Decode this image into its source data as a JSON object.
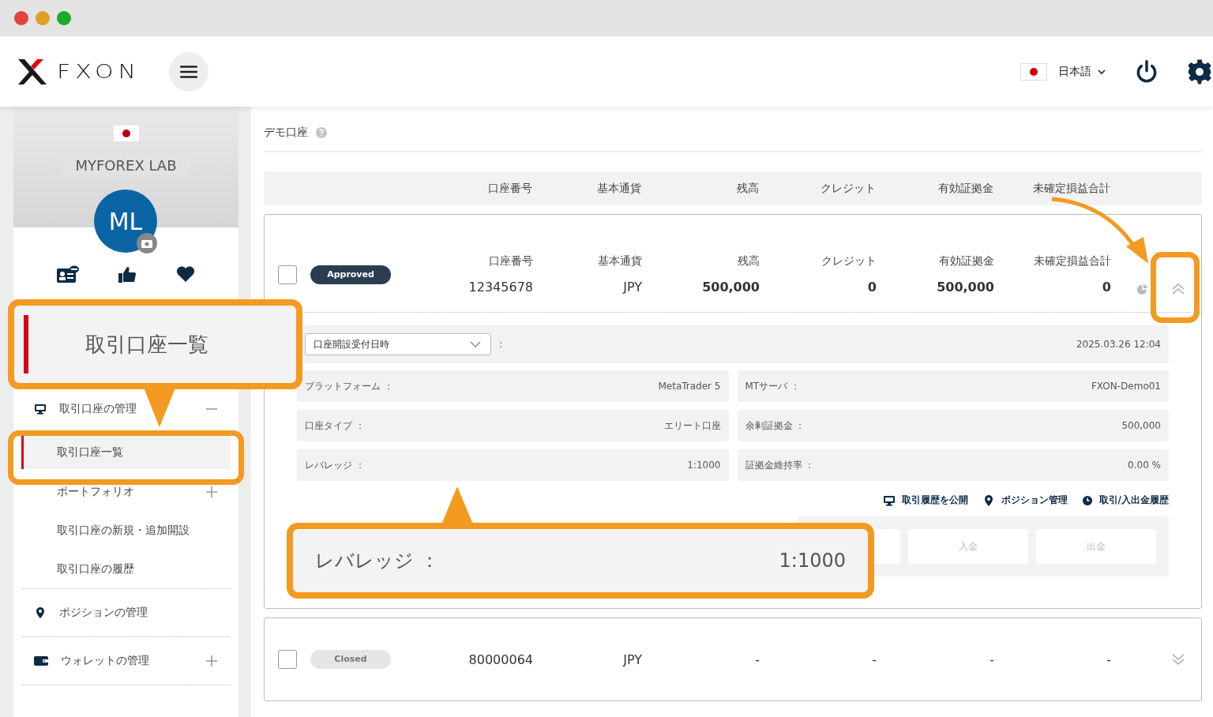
{
  "header": {
    "logo": "FXON",
    "language": "日本語"
  },
  "profile": {
    "name": "MYFOREX LAB",
    "initials": "ML"
  },
  "sidebar": {
    "menu": [
      {
        "label": "取引口座の管理",
        "expanded": true,
        "children": [
          {
            "label": "取引口座一覧",
            "selected": true
          },
          {
            "label": "ポートフォリオ",
            "selected": false,
            "expanded": false
          },
          {
            "label": "取引口座の新規・追加開設",
            "selected": false
          },
          {
            "label": "取引口座の履歴",
            "selected": false
          }
        ]
      },
      {
        "label": "ポジションの管理"
      },
      {
        "label": "ウォレットの管理",
        "expanded": false
      }
    ]
  },
  "section": {
    "title": "デモ口座"
  },
  "columns": [
    "口座番号",
    "基本通貨",
    "残高",
    "クレジット",
    "有効証拠金",
    "未確定損益合計"
  ],
  "accounts": [
    {
      "checked": false,
      "status": "Approved",
      "color": "#2b3d50",
      "expanded": true,
      "labels": [
        "口座番号",
        "基本通貨",
        "残高",
        "クレジット",
        "有効証拠金",
        "未確定損益合計"
      ],
      "values": [
        "12345678",
        "JPY",
        "500,000",
        "0",
        "500,000",
        "0"
      ],
      "details": {
        "select": "口座開設受付日時",
        "separator": ":",
        "date": "2025.03.26 12:04",
        "fields": [
          {
            "label": "プラットフォーム ：",
            "value": "MetaTrader 5"
          },
          {
            "label": "MTサーバ ：",
            "value": "FXON-Demo01"
          },
          {
            "label": "口座タイプ ：",
            "value": "エリート口座"
          },
          {
            "label": "余剰証拠金 ：",
            "value": "500,000"
          },
          {
            "label": "レバレッジ ：",
            "value": "1:1000"
          },
          {
            "label": "証拠金維持率 ：",
            "value": "0.00 %"
          }
        ],
        "links": [
          "取引履歴を公開",
          "ポジション管理",
          "取引/入出金履歴"
        ],
        "buttons": [
          "入金",
          "出金"
        ]
      }
    },
    {
      "checked": false,
      "status": "Closed",
      "color": "#e6e6e6",
      "expanded": false,
      "values": [
        "80000064",
        "JPY",
        "-",
        "-",
        "-",
        "-"
      ]
    }
  ],
  "callouts": [
    {
      "kind": "menu",
      "text": "取引口座一覧"
    },
    {
      "kind": "field",
      "label": "レバレッジ ：",
      "value": "1:1000"
    }
  ]
}
